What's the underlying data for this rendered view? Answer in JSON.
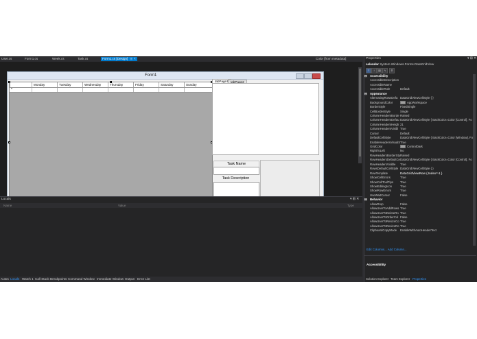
{
  "doc_tabs": [
    {
      "label": "User.cs",
      "active": false
    },
    {
      "label": "Form1.cs",
      "active": false
    },
    {
      "label": "Week.cs",
      "active": false
    },
    {
      "label": "Task.cs",
      "active": false
    },
    {
      "label": "Form1.cs [Design]",
      "active": true
    },
    {
      "label": "Color [from metadata]",
      "active": false
    }
  ],
  "form": {
    "title": "Form1",
    "grid_columns": [
      "Monday",
      "Tuesday",
      "Wednesday",
      "Thursday",
      "Friday",
      "Saturday",
      "Sunday"
    ],
    "new_row_marker": "*",
    "tab_pages": [
      "tabPage1",
      "tabPage2"
    ],
    "task_name_label": "Task Name",
    "task_description_label": "Task Description"
  },
  "locals": {
    "title": "Locals",
    "pin": "▾ ⊞ ✕",
    "columns": {
      "name": "Name",
      "value": "Value",
      "type": "Type"
    }
  },
  "bottom_tabs": [
    {
      "label": "Autos",
      "active": false
    },
    {
      "label": "Locals",
      "active": true
    },
    {
      "label": "Watch 1",
      "active": false
    },
    {
      "label": "Call Stack",
      "active": false
    },
    {
      "label": "Breakpoints",
      "active": false
    },
    {
      "label": "Command Window",
      "active": false
    },
    {
      "label": "Immediate Window",
      "active": false
    },
    {
      "label": "Output",
      "active": false
    },
    {
      "label": "Error List",
      "active": false
    }
  ],
  "properties": {
    "title": "Properties",
    "pin": "▾ ⊞ ✕",
    "object_name": "calendar",
    "object_type": "System.Windows.Forms.DataGridView",
    "rows": [
      {
        "cat": true,
        "name": "Accessibility"
      },
      {
        "name": "AccessibleDescription",
        "value": ""
      },
      {
        "name": "AccessibleName",
        "value": ""
      },
      {
        "name": "AccessibleRole",
        "value": "Default"
      },
      {
        "cat": true,
        "name": "Appearance"
      },
      {
        "name": "AlternatingRowsDefa",
        "value": "DataGridViewCellStyle { }"
      },
      {
        "name": "BackgroundColor",
        "value": "AppWorkspace",
        "swatch": "#a0a0a0"
      },
      {
        "name": "BorderStyle",
        "value": "FixedSingle"
      },
      {
        "name": "CellBorderStyle",
        "value": "Single"
      },
      {
        "name": "ColumnHeadersBorde",
        "value": "Raised"
      },
      {
        "name": "ColumnHeadersDefau",
        "value": "DataGridViewCellStyle { BackColor=Color [Control], Fo"
      },
      {
        "name": "ColumnHeadersHeigh",
        "value": "21"
      },
      {
        "name": "ColumnHeadersVisibl",
        "value": "True"
      },
      {
        "name": "Cursor",
        "value": "Default"
      },
      {
        "name": "DefaultCellStyle",
        "value": "DataGridViewCellStyle { BackColor=Color [Window], Fo"
      },
      {
        "name": "EnableHeadersVisualS",
        "value": "True"
      },
      {
        "name": "GridColor",
        "value": "ControlDark",
        "swatch": "#a0a0a0"
      },
      {
        "name": "RightToLeft",
        "value": "No"
      },
      {
        "name": "RowHeadersBorderSty",
        "value": "Raised"
      },
      {
        "name": "RowHeadersDefaultCe",
        "value": "DataGridViewCellStyle { BackColor=Color [Control], Fo"
      },
      {
        "name": "RowHeadersVisible",
        "value": "True"
      },
      {
        "name": "RowsDefaultCellStyle",
        "value": "DataGridViewCellStyle { }"
      },
      {
        "name": "RowTemplate",
        "value": "DataGridViewRow { Index=-1 }",
        "bold": true
      },
      {
        "name": "ShowCellErrors",
        "value": "True"
      },
      {
        "name": "ShowCellToolTips",
        "value": "True"
      },
      {
        "name": "ShowEditingIcon",
        "value": "True"
      },
      {
        "name": "ShowRowErrors",
        "value": "True"
      },
      {
        "name": "UseWaitCursor",
        "value": "False"
      },
      {
        "cat": true,
        "name": "Behavior"
      },
      {
        "name": "AllowDrop",
        "value": "False"
      },
      {
        "name": "AllowUserToAddRows",
        "value": "True"
      },
      {
        "name": "AllowUserToDeleteRo",
        "value": "True"
      },
      {
        "name": "AllowUserToOrderCol",
        "value": "False"
      },
      {
        "name": "AllowUserToResizeCo",
        "value": "True"
      },
      {
        "name": "AllowUserToResizeRo",
        "value": "True"
      },
      {
        "name": "ClipboardCopyMode",
        "value": "EnableWithAutoHeaderText"
      }
    ],
    "links": "Edit Columns... Add Column...",
    "description_title": "Accessibility"
  },
  "props_tabs": [
    {
      "label": "Solution Explorer",
      "active": false
    },
    {
      "label": "Team Explorer",
      "active": false
    },
    {
      "label": "Properties",
      "active": true
    }
  ]
}
